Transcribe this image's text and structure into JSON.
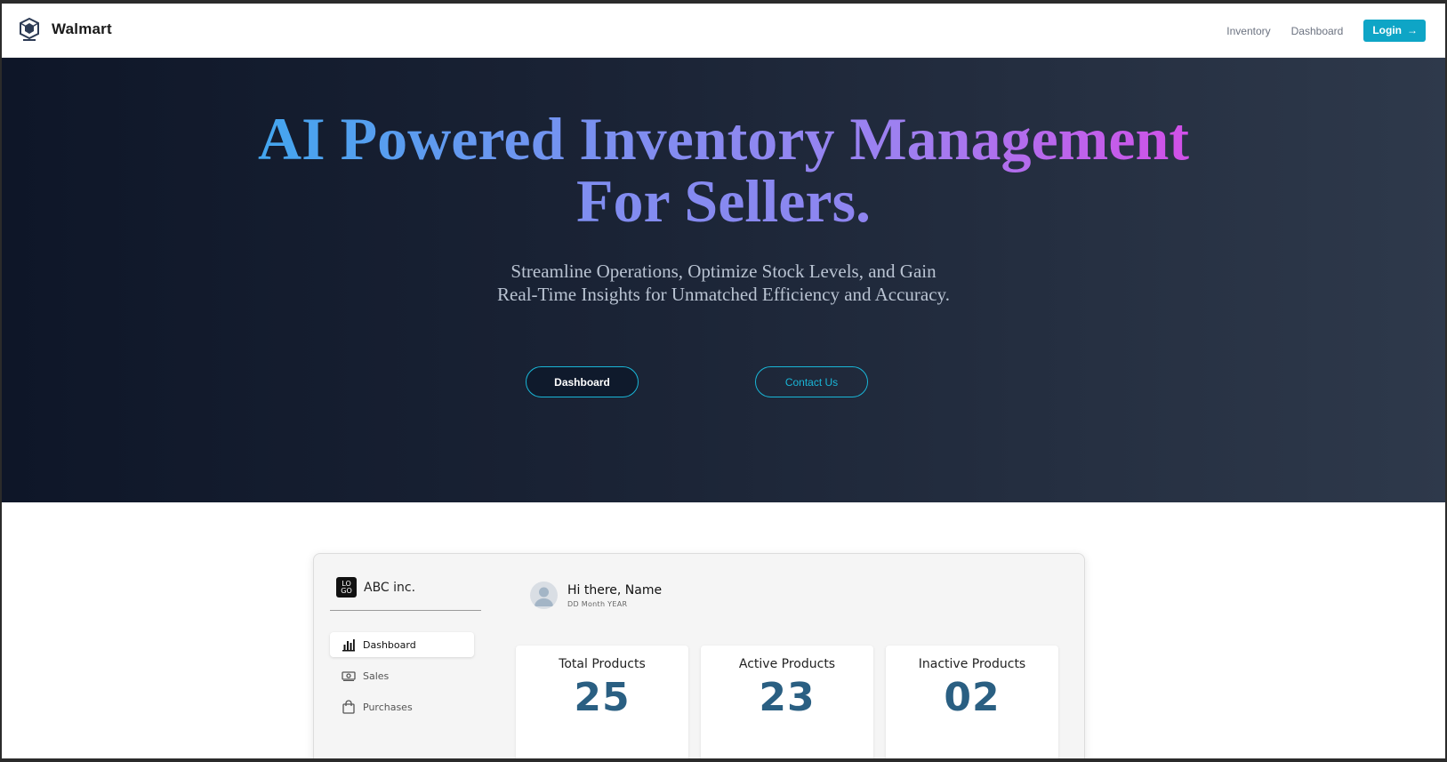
{
  "nav": {
    "brand": "Walmart",
    "links": [
      "Inventory",
      "Dashboard"
    ],
    "login_label": "Login",
    "login_icon": "arrow-right-icon",
    "accent_color": "#0ea5c6"
  },
  "hero": {
    "title_line1": "AI Powered Inventory Management",
    "title_line2": "For Sellers.",
    "subtitle_line1": "Streamline Operations, Optimize Stock Levels, and Gain",
    "subtitle_line2": "Real-Time Insights for Unmatched Efficiency and Accuracy.",
    "dashboard_button": "Dashboard",
    "contact_button": "Contact Us",
    "gradient_colors": [
      "#43a6ef",
      "#9f7ff0",
      "#d150e8"
    ]
  },
  "preview": {
    "logo_text_top": "LO",
    "logo_text_bottom": "GO",
    "company": "ABC inc.",
    "menu": [
      {
        "label": "Dashboard",
        "icon": "bar-chart-icon"
      },
      {
        "label": "Sales",
        "icon": "cash-icon"
      },
      {
        "label": "Purchases",
        "icon": "shopping-bag-icon"
      }
    ],
    "greeting": "Hi there, Name",
    "date": "DD Month YEAR",
    "stats": [
      {
        "label": "Total Products",
        "value": "25"
      },
      {
        "label": "Active Products",
        "value": "23"
      },
      {
        "label": "Inactive Products",
        "value": "02"
      }
    ]
  }
}
